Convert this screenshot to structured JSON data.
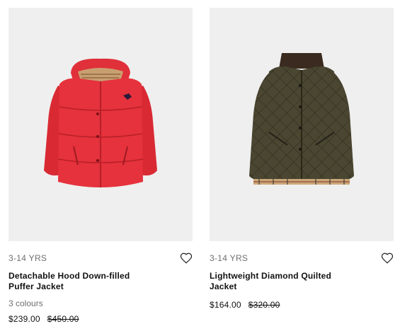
{
  "products": [
    {
      "age": "3-14 YRS",
      "title_line1": "Detachable Hood Down-filled",
      "title_line2": "Puffer Jacket",
      "colours": "3 colours",
      "price": "$239.00",
      "was_price": "$450.00",
      "image": "red-puffer-jacket",
      "color": "#e5323c",
      "wishlist_icon": "heart-icon"
    },
    {
      "age": "3-14 YRS",
      "title_line1": "Lightweight Diamond Quilted",
      "title_line2": "Jacket",
      "price": "$164.00",
      "was_price": "$320.00",
      "image": "olive-quilted-jacket",
      "color": "#4a4631",
      "wishlist_icon": "heart-icon"
    }
  ],
  "colors": {
    "image_background": "#efefef",
    "muted_text": "#6f6f6f"
  }
}
